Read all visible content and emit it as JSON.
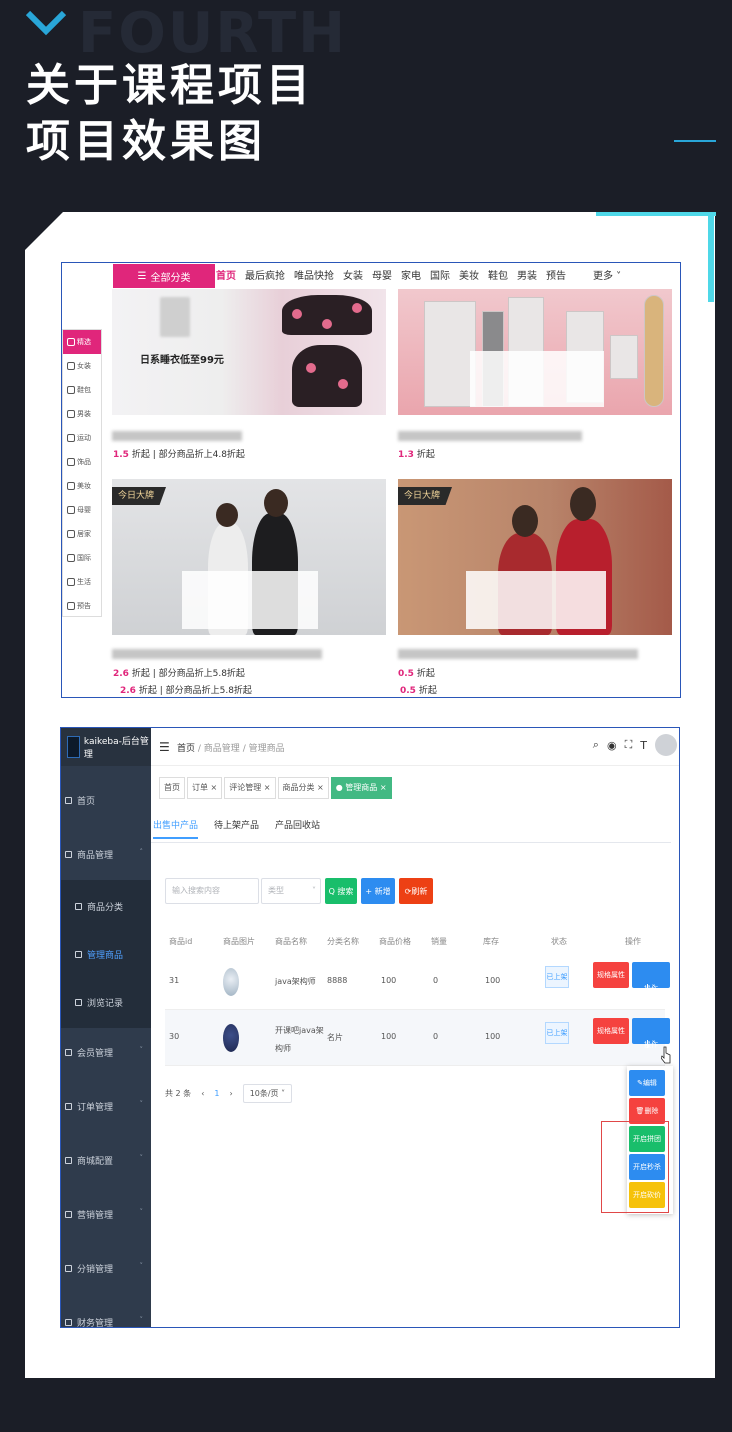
{
  "header": {
    "bg_word": "FOURTH",
    "title_line1": "关于课程项目",
    "title_line2": "项目效果图",
    "accent_color": "#29a6d8"
  },
  "shop": {
    "all_categories": "全部分类",
    "nav": [
      "首页",
      "最后疯抢",
      "唯品快抢",
      "女装",
      "母婴",
      "家电",
      "国际",
      "美妆",
      "鞋包",
      "男装",
      "预告"
    ],
    "nav_more": "更多",
    "side_categories": [
      "精选",
      "女装",
      "鞋包",
      "男装",
      "运动",
      "饰品",
      "美妆",
      "母婴",
      "居家",
      "国际",
      "生活",
      "预告"
    ],
    "tile1_caption": "日系睡衣低至99元",
    "brand_tag": "今日大牌",
    "tiles": [
      {
        "discount": "1.5",
        "unit": "折起",
        "desc": "部分商品折上4.8折起"
      },
      {
        "discount": "1.3",
        "unit": "折起",
        "desc": ""
      },
      {
        "discount": "2.6",
        "unit": "折起",
        "desc": "部分商品折上5.8折起",
        "dup_discount": "2.6",
        "dup_desc": "部分商品折上5.8折起"
      },
      {
        "discount": "0.5",
        "unit": "折起",
        "desc": "",
        "dup_discount": "0.5"
      }
    ],
    "accent": "#e0267b"
  },
  "admin": {
    "brand": "kaikeba-后台管理",
    "menu": [
      "首页",
      "商品管理",
      "商品分类",
      "管理商品",
      "浏览记录",
      "会员管理",
      "订单管理",
      "商城配置",
      "营销管理",
      "分销管理",
      "财务管理"
    ],
    "breadcrumb": {
      "home": "首页",
      "mid": "商品管理",
      "cur": "管理商品"
    },
    "tags": [
      "首页",
      "订单",
      "评论管理",
      "商品分类",
      "管理商品"
    ],
    "tabs": [
      "出售中产品",
      "待上架产品",
      "产品回收站"
    ],
    "search_placeholder": "输入搜索内容",
    "select_placeholder": "类型",
    "btn_search": "Q 搜索",
    "btn_add": "+ 新增",
    "btn_refresh": "刷新",
    "columns": [
      "商品id",
      "商品图片",
      "商品名称",
      "分类名称",
      "商品价格",
      "销量",
      "库存",
      "状态",
      "操作"
    ],
    "rows": [
      {
        "id": "31",
        "name": "java架构师",
        "cat": "8888",
        "price": "100",
        "sales": "0",
        "stock": "100",
        "status": "已上架"
      },
      {
        "id": "30",
        "name": "开课吧java架构师",
        "cat": "名片",
        "price": "100",
        "sales": "0",
        "stock": "100",
        "status": "已上架"
      }
    ],
    "row_btn_attr": "规格属性",
    "row_btn_op": "操作",
    "pager_total": "共 2 条",
    "pager_page": "1",
    "pager_size": "10条/页",
    "dropdown": [
      "编辑",
      "删除",
      "开启拼团",
      "开启秒杀",
      "开启砍价"
    ],
    "colors": {
      "sidebar": "#2f3b4c",
      "primary": "#409eff",
      "success": "#42b983",
      "danger": "#f5423f",
      "warning": "#f6c20a"
    }
  }
}
